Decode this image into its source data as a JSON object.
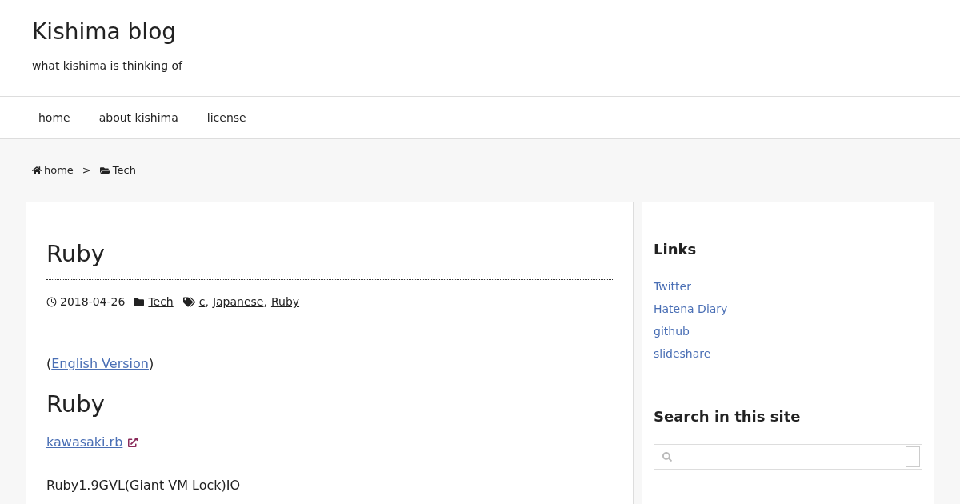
{
  "site": {
    "title": "Kishima blog",
    "tagline": "what kishima is thinking of"
  },
  "nav": [
    "home",
    "about kishima",
    "license"
  ],
  "breadcrumb": {
    "home": "home",
    "separator": ">",
    "category": "Tech"
  },
  "post": {
    "title": "Ruby",
    "date": "2018-04-26",
    "category": "Tech",
    "tags": [
      "c",
      "Japanese",
      "Ruby"
    ],
    "tag_separator": ",",
    "intro": {
      "before": "(",
      "link": "English Version",
      "after": ")"
    },
    "heading": "Ruby",
    "external_link": "kawasaki.rb",
    "paragraph": "Ruby1.9GVL(Giant VM Lock)IO"
  },
  "sidebar": {
    "links_title": "Links",
    "links": [
      "Twitter",
      "Hatena Diary",
      "github",
      "slideshare"
    ],
    "search_title": "Search in this site"
  }
}
